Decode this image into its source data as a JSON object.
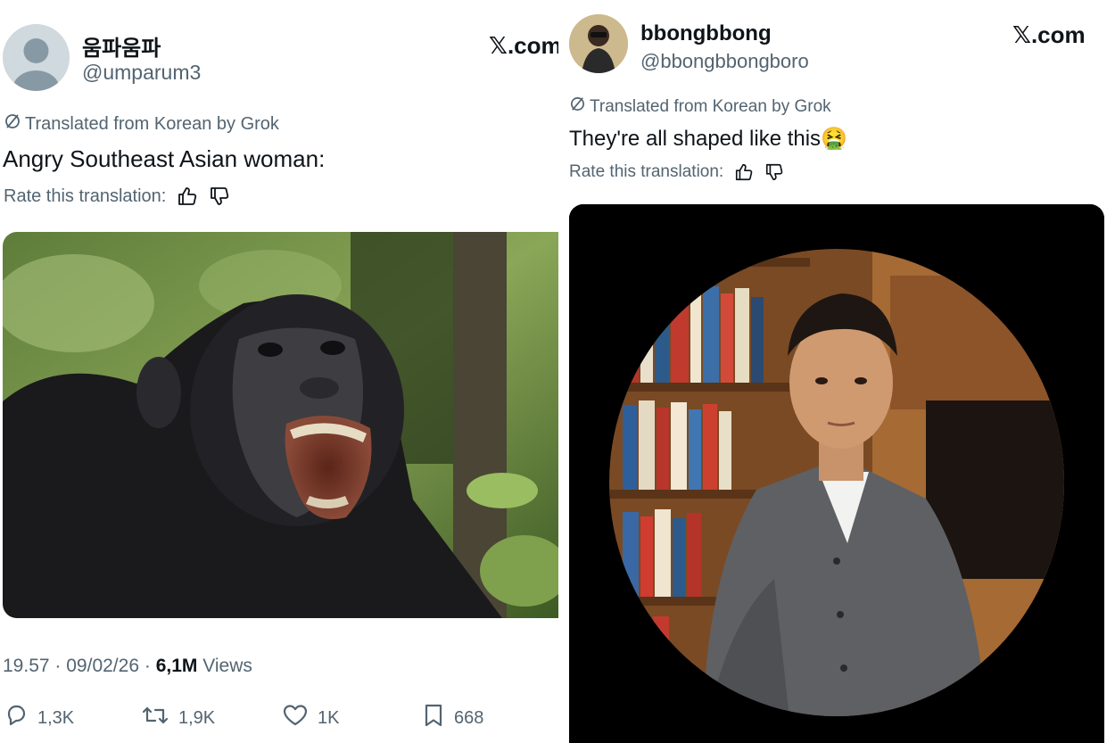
{
  "left_tweet": {
    "display_name": "움파움파",
    "handle": "@umparum3",
    "x_logo": "𝕏.com",
    "translated_label": "Translated from Korean by Grok",
    "text": "Angry Southeast Asian woman:",
    "rate_label": "Rate this translation:",
    "time": "19.57",
    "date": "09/02/26",
    "views_count": "6,1M",
    "views_label": "Views",
    "separator": "·",
    "actions": {
      "replies": "1,3K",
      "reposts": "1,9K",
      "likes": "1K",
      "bookmarks": "668"
    },
    "media_icon": "chimpanzee-photo"
  },
  "right_tweet": {
    "display_name": "bbongbbong",
    "handle": "@bbongbbongboro",
    "x_logo": "𝕏.com",
    "translated_label": "Translated from Korean by Grok",
    "text": "They're all shaped like this",
    "emoji": "🤮",
    "rate_label": "Rate this translation:",
    "media_icon": "man-bookshelf-photo"
  },
  "colors": {
    "text_primary": "#0f1419",
    "text_secondary": "#536471",
    "media_black": "#000000"
  }
}
